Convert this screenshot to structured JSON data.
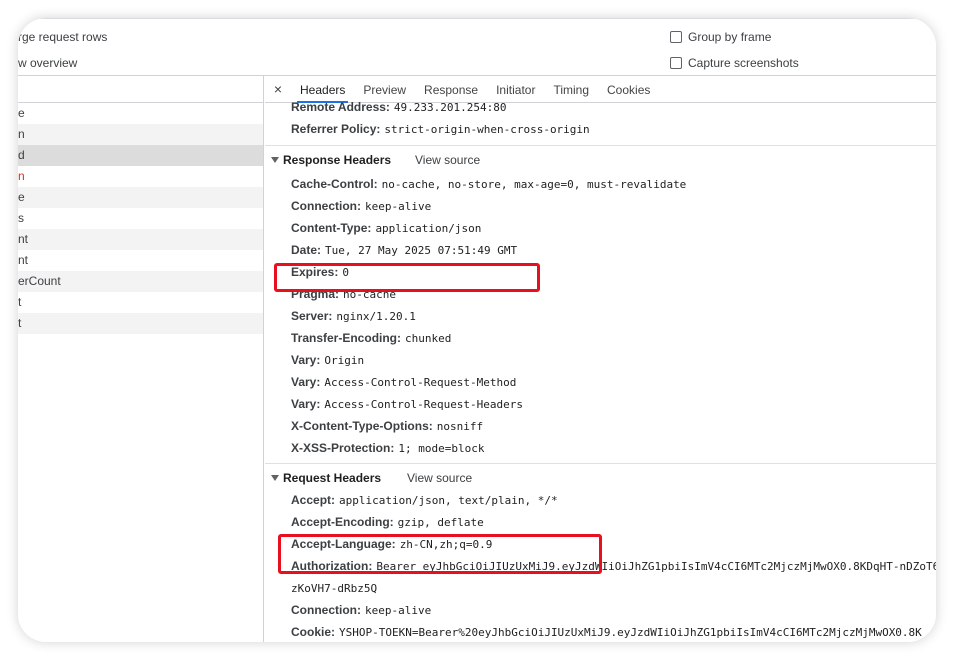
{
  "settings": {
    "large_rows": "rge request rows",
    "overview": "w overview",
    "group_by_frame": "Group by frame",
    "capture_screenshots": "Capture screenshots"
  },
  "request_list": [
    {
      "text": "e",
      "state": "normal"
    },
    {
      "text": "n",
      "state": "alt"
    },
    {
      "text": "d",
      "state": "selected"
    },
    {
      "text": "n",
      "state": "error"
    },
    {
      "text": "e",
      "state": "alt"
    },
    {
      "text": "s",
      "state": "normal"
    },
    {
      "text": "nt",
      "state": "alt"
    },
    {
      "text": "nt",
      "state": "normal"
    },
    {
      "text": "erCount",
      "state": "alt"
    },
    {
      "text": "t",
      "state": "normal"
    },
    {
      "text": "t",
      "state": "alt"
    }
  ],
  "tabs": {
    "close": "×",
    "headers": "Headers",
    "preview": "Preview",
    "response": "Response",
    "initiator": "Initiator",
    "timing": "Timing",
    "cookies": "Cookies"
  },
  "general": {
    "remote_address_key": "Remote Address:",
    "remote_address_value": "49.233.201.254:80",
    "referrer_policy_key": "Referrer Policy:",
    "referrer_policy_value": "strict-origin-when-cross-origin"
  },
  "response_headers": {
    "title": "Response Headers",
    "view_source": "View source",
    "items": [
      {
        "key": "Cache-Control:",
        "value": "no-cache, no-store, max-age=0, must-revalidate"
      },
      {
        "key": "Connection:",
        "value": "keep-alive"
      },
      {
        "key": "Content-Type:",
        "value": "application/json"
      },
      {
        "key": "Date:",
        "value": "Tue, 27 May 2025 07:51:49 GMT"
      },
      {
        "key": "Expires:",
        "value": "0"
      },
      {
        "key": "Pragma:",
        "value": "no-cache"
      },
      {
        "key": "Server:",
        "value": "nginx/1.20.1"
      },
      {
        "key": "Transfer-Encoding:",
        "value": "chunked"
      },
      {
        "key": "Vary:",
        "value": "Origin"
      },
      {
        "key": "Vary:",
        "value": "Access-Control-Request-Method"
      },
      {
        "key": "Vary:",
        "value": "Access-Control-Request-Headers"
      },
      {
        "key": "X-Content-Type-Options:",
        "value": "nosniff"
      },
      {
        "key": "X-XSS-Protection:",
        "value": "1; mode=block"
      }
    ]
  },
  "request_headers": {
    "title": "Request Headers",
    "view_source": "View source",
    "accept_key": "Accept:",
    "accept_value": "application/json, text/plain, */*",
    "accept_encoding_key": "Accept-Encoding:",
    "accept_encoding_value": "gzip, deflate",
    "accept_language_key": "Accept-Language:",
    "accept_language_value": "zh-CN,zh;q=0.9",
    "authorization_key": "Authorization:",
    "authorization_value": "Bearer eyJhbGciOiJIUzUxMiJ9.eyJzdWIiOiJhZG1pbiIsImV4cCI6MTc2MjczMjMwOX0.8KDqHT-nDZoT6",
    "authorization_cont": "zKoVH7-dRbz5Q",
    "connection_key": "Connection:",
    "connection_value": "keep-alive",
    "cookie_key": "Cookie:",
    "cookie_value": "YSHOP-TOEKN=Bearer%20eyJhbGciOiJIUzUxMiJ9.eyJzdWIiOiJhZG1pbiIsImV4cCI6MTc2MjczMjMwOX0.8K"
  },
  "colors": {
    "highlight": "#e8101f",
    "active_tab": "#1a73e8",
    "error_text": "#d93025"
  }
}
